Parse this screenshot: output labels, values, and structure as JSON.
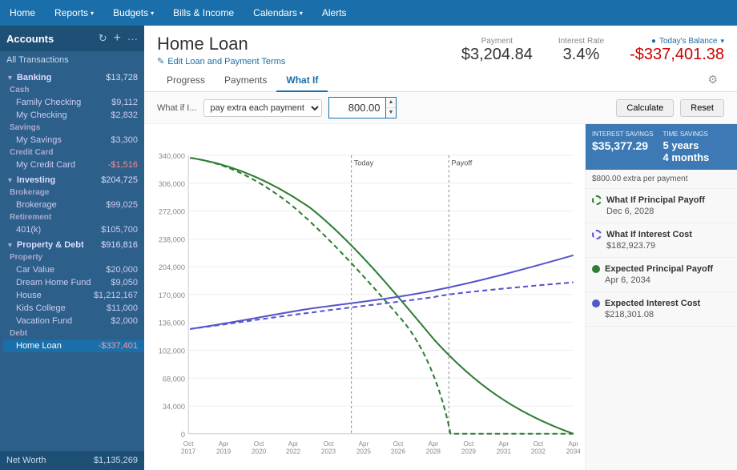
{
  "nav": {
    "items": [
      {
        "label": "Home",
        "active": false
      },
      {
        "label": "Reports",
        "active": false,
        "hasMenu": true
      },
      {
        "label": "Budgets",
        "active": false,
        "hasMenu": true
      },
      {
        "label": "Bills & Income",
        "active": false
      },
      {
        "label": "Calendars",
        "active": false,
        "hasMenu": true
      },
      {
        "label": "Alerts",
        "active": false
      }
    ]
  },
  "sidebar": {
    "title": "Accounts",
    "all_transactions": "All Transactions",
    "groups": [
      {
        "name": "Banking",
        "total": "$13,728",
        "subgroups": [
          {
            "name": "Cash",
            "items": [
              {
                "name": "Family Checking",
                "value": "$9,112"
              },
              {
                "name": "My Checking",
                "value": "$2,832"
              }
            ]
          },
          {
            "name": "Savings",
            "items": [
              {
                "name": "My Savings",
                "value": "$3,300"
              }
            ]
          },
          {
            "name": "Credit Card",
            "items": [
              {
                "name": "My Credit Card",
                "value": "-$1,516",
                "negative": true
              }
            ]
          }
        ]
      },
      {
        "name": "Investing",
        "total": "$204,725",
        "subgroups": [
          {
            "name": "Brokerage",
            "items": [
              {
                "name": "Brokerage",
                "value": "$99,025"
              }
            ]
          },
          {
            "name": "Retirement",
            "items": [
              {
                "name": "401(k)",
                "value": "$105,700"
              }
            ]
          }
        ]
      },
      {
        "name": "Property & Debt",
        "total": "$916,816",
        "subgroups": [
          {
            "name": "Property",
            "items": [
              {
                "name": "Car Value",
                "value": "$20,000"
              },
              {
                "name": "Dream Home Fund",
                "value": "$9,050"
              },
              {
                "name": "House",
                "value": "$1,212,167"
              },
              {
                "name": "Kids College",
                "value": "$11,000"
              },
              {
                "name": "Vacation Fund",
                "value": "$2,000"
              }
            ]
          },
          {
            "name": "Debt",
            "items": [
              {
                "name": "Home Loan",
                "value": "-$337,401",
                "negative": true,
                "selected": true
              }
            ]
          }
        ]
      }
    ],
    "net_worth_label": "Net Worth",
    "net_worth_value": "$1,135,269"
  },
  "content": {
    "title": "Home Loan",
    "edit_label": "Edit Loan and Payment Terms",
    "payment_label": "Payment",
    "payment_value": "$3,204.84",
    "interest_label": "Interest Rate",
    "interest_value": "3.4%",
    "today_label": "Today's Balance",
    "today_value": "-$337,401.38",
    "tabs": [
      "Progress",
      "Payments",
      "What If"
    ],
    "active_tab": "What If",
    "whatif_label": "What if I...",
    "whatif_option": "pay extra each payment",
    "whatif_input": "800.00",
    "calculate_label": "Calculate",
    "reset_label": "Reset"
  },
  "chart_sidebar": {
    "interest_savings_label": "INTEREST SAVINGS",
    "interest_savings_value": "$35,377.29",
    "time_savings_label": "TIME SAVINGS",
    "time_savings_value": "5 years\n4 months",
    "extra_payment": "$800.00 extra per payment",
    "items": [
      {
        "type": "dashed-green",
        "label": "What If Principal Payoff",
        "value": "Dec 6, 2028"
      },
      {
        "type": "dashed-blue",
        "label": "What If Interest Cost",
        "value": "$182,923.79"
      },
      {
        "type": "solid-green",
        "label": "Expected Principal Payoff",
        "value": "Apr 6, 2034"
      },
      {
        "type": "solid-blue",
        "label": "Expected Interest Cost",
        "value": "$218,301.08"
      }
    ]
  },
  "chart": {
    "y_labels": [
      "340,000",
      "306,000",
      "272,000",
      "238,000",
      "204,000",
      "170,000",
      "136,000",
      "102,000",
      "68,000",
      "34,000",
      "0"
    ],
    "x_labels": [
      "Oct\n2017",
      "Apr\n2019",
      "Oct\n2020",
      "Apr\n2022",
      "Oct\n2023",
      "Apr\n2025",
      "Oct\n2026",
      "Apr\n2028",
      "Oct\n2029",
      "Apr\n2031",
      "Oct\n2032",
      "Apr\n2034"
    ],
    "today_label": "Today",
    "payoff_label": "Payoff"
  }
}
